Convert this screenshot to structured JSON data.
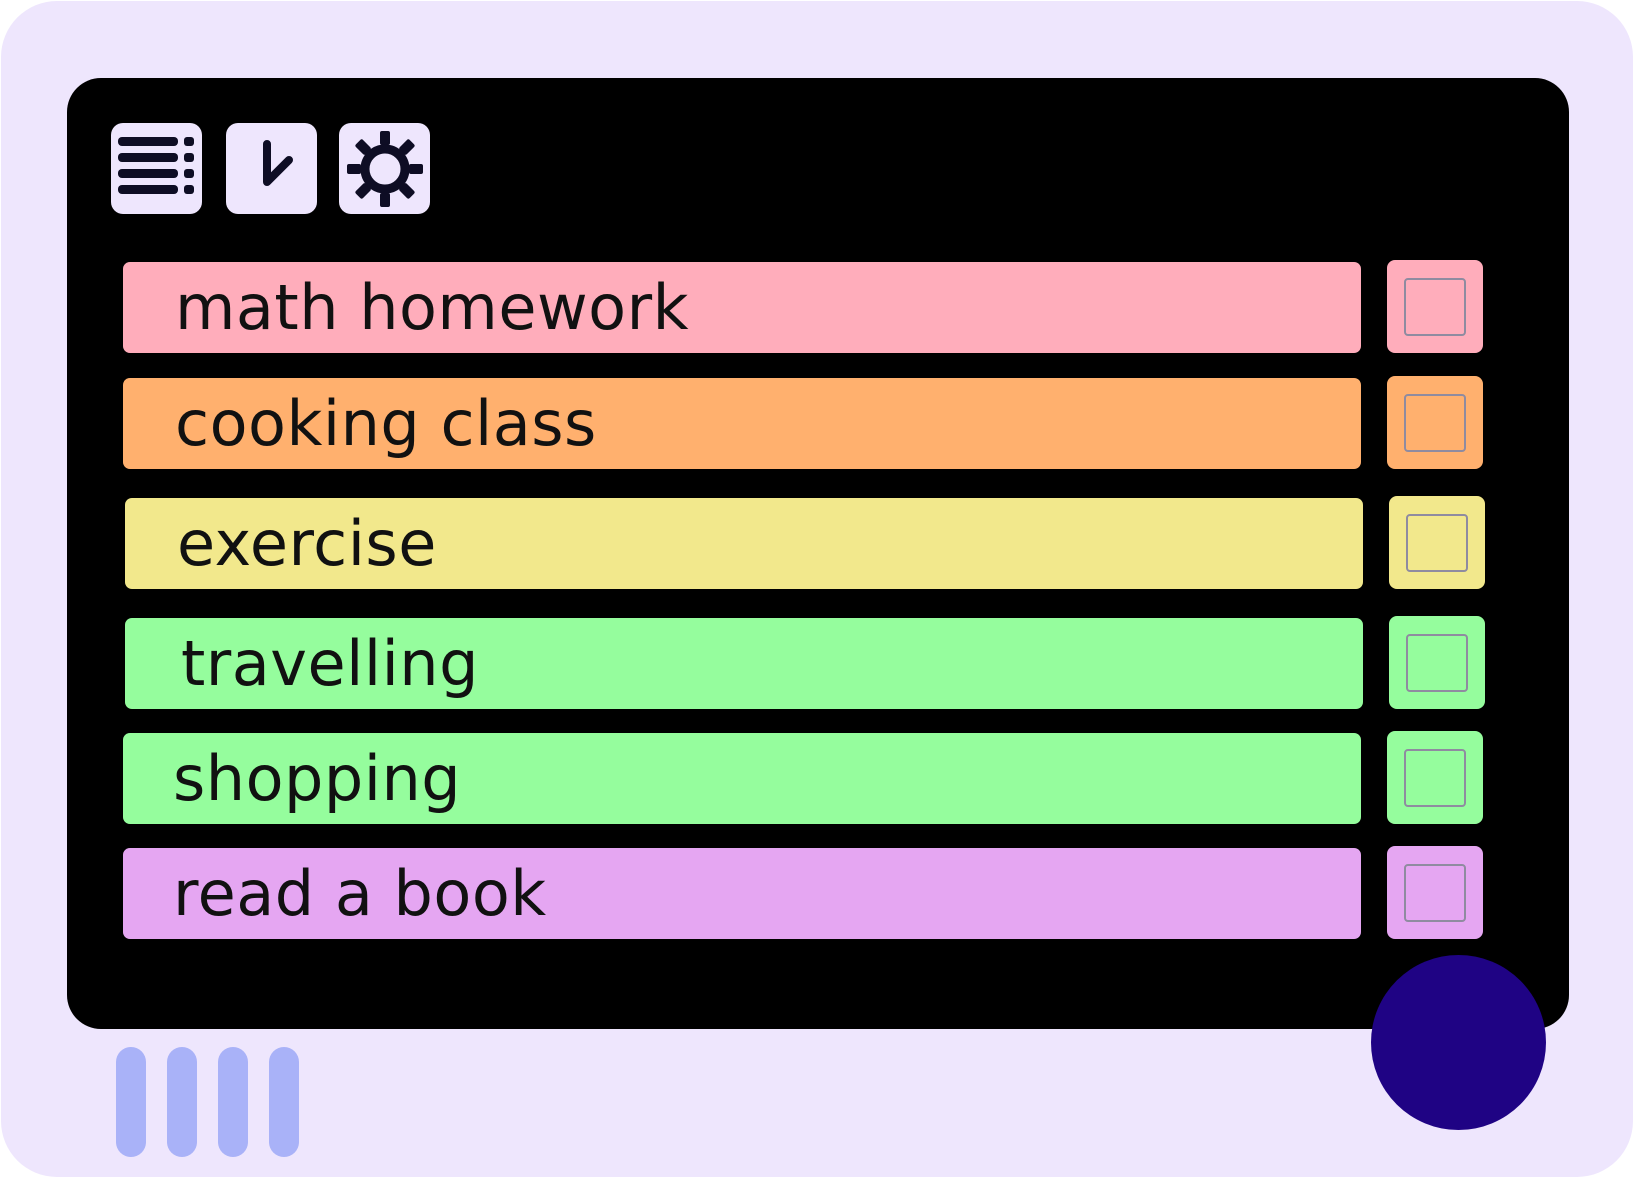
{
  "toolbar": {
    "icons": [
      "list-icon",
      "clock-icon",
      "gear-icon"
    ]
  },
  "todos": [
    {
      "label": "math homework",
      "color": "#ffadbb",
      "checked": false
    },
    {
      "label": "cooking class",
      "color": "#ffb06e",
      "checked": false
    },
    {
      "label": "exercise",
      "color": "#f2e88c",
      "checked": false
    },
    {
      "label": "travelling",
      "color": "#95fd9d",
      "checked": false
    },
    {
      "label": "shopping",
      "color": "#95fd9d",
      "checked": false
    },
    {
      "label": "read a book",
      "color": "#e5a6f2",
      "checked": false
    }
  ],
  "colors": {
    "device": "#eee6fd",
    "screen": "#000000",
    "fab": "#1f0384",
    "grip": "#a9b2f8",
    "icon_fg": "#0e0d24"
  }
}
